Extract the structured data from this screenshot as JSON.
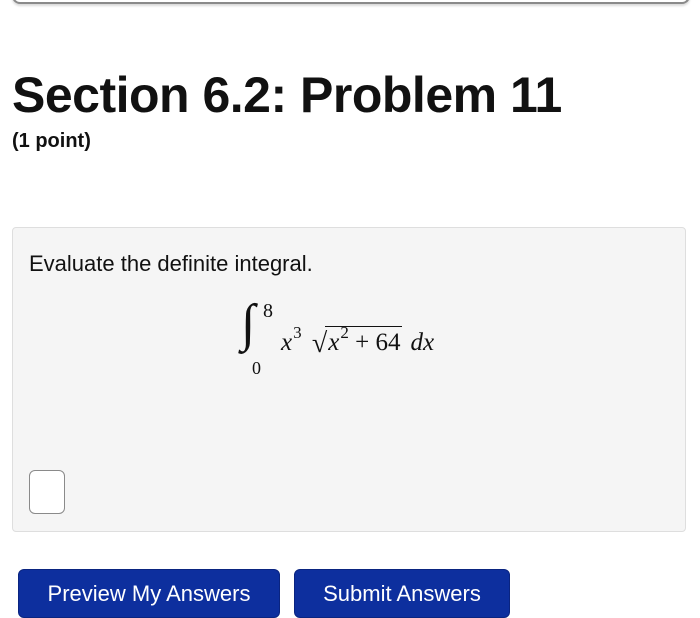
{
  "page": {
    "title": "Section 6.2: Problem 11",
    "points": "(1 point)"
  },
  "problem": {
    "instruction": "Evaluate the definite integral.",
    "integral": {
      "upper_limit": "8",
      "lower_limit": "0",
      "integrand_var": "x",
      "power": "3",
      "radicand_var": "x",
      "radicand_power": "2",
      "radicand_rest": " + 64",
      "differential": "dx"
    },
    "answer_value": ""
  },
  "buttons": {
    "preview_label": "Preview My Answers",
    "submit_label": "Submit Answers"
  },
  "colors": {
    "button_bg": "#0d2f9e",
    "problem_bg": "#f5f5f5"
  }
}
